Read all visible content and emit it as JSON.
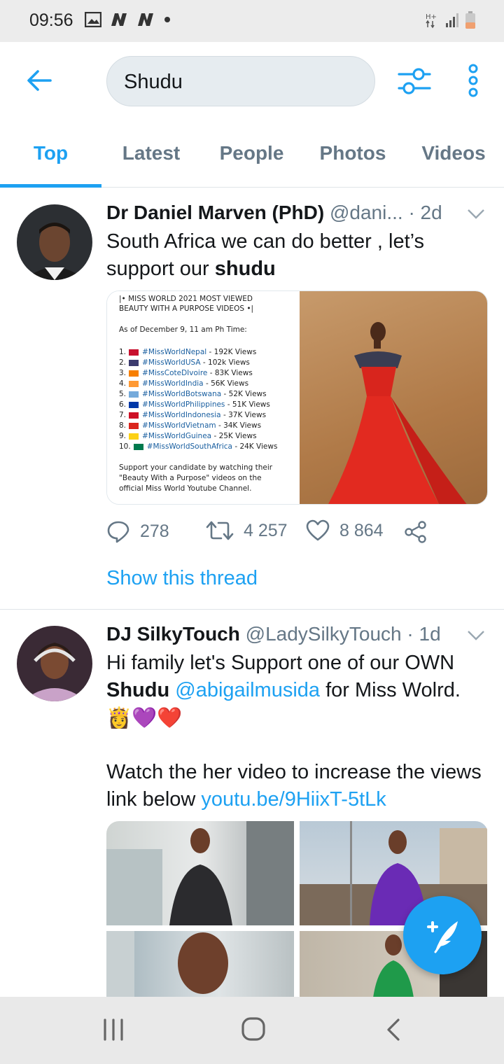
{
  "status_bar": {
    "time": "09:56"
  },
  "search": {
    "query": "Shudu"
  },
  "tabs": [
    {
      "label": "Top"
    },
    {
      "label": "Latest"
    },
    {
      "label": "People"
    },
    {
      "label": "Photos"
    },
    {
      "label": "Videos"
    }
  ],
  "tweets": [
    {
      "name": "Dr Daniel Marven (PhD)",
      "handle": "@dani...",
      "time": "· 2d",
      "text_1": "South Africa we can do better , let’s support our ",
      "text_bold": "shudu",
      "image_card": {
        "title_line1": "|• MISS WORLD 2021 MOST VIEWED",
        "title_line2": "BEAUTY WITH A PURPOSE VIDEOS •|",
        "asof": "As of December 9, 11 am Ph Time:",
        "rows": [
          {
            "n": "1.",
            "tag": "#MissWorldNepal",
            "views": " - 192K Views"
          },
          {
            "n": "2.",
            "tag": "#MissWorldUSA",
            "views": " - 102k Views"
          },
          {
            "n": "3.",
            "tag": "#MissCoteDIvoire",
            "views": " - 83K Views"
          },
          {
            "n": "4.",
            "tag": "#MissWorldIndia",
            "views": " - 56K Views"
          },
          {
            "n": "5.",
            "tag": "#MissWorldBotswana",
            "views": " - 52K Views"
          },
          {
            "n": "6.",
            "tag": "#MissWorldPhilippines",
            "views": " - 51K Views"
          },
          {
            "n": "7.",
            "tag": "#MissWorldIndonesia",
            "views": " - 37K Views"
          },
          {
            "n": "8.",
            "tag": "#MissWorldVietnam",
            "views": " - 34K Views"
          },
          {
            "n": "9.",
            "tag": "#MissWorldGuinea",
            "views": " - 25K Views"
          },
          {
            "n": "10.",
            "tag": "#MissWorldSouthAfrica",
            "views": " - 24K Views"
          }
        ],
        "footer_1": "Support your candidate by watching their",
        "footer_2": "\"Beauty With a Purpose\" videos on the",
        "footer_3": "official Miss World Youtube Channel."
      },
      "replies": "278",
      "retweets": "4 257",
      "likes": "8 864",
      "show_thread": "Show this thread"
    },
    {
      "name": "DJ SilkyTouch",
      "handle": "@LadySilkyTouch",
      "time": "· 1d",
      "text_1": "Hi family let's Support one of our OWN",
      "text_bold": "Shudu",
      "mention": "@abigailmusida",
      "text_2": " for Miss Wolrd.",
      "emoji": "👸💜❤️",
      "text_3": "Watch the her video to increase the views link below ",
      "link": "youtu.be/9HiixT-5tLk"
    }
  ],
  "colors": {
    "accent": "#1da1f2",
    "secondary_text": "#657786"
  }
}
